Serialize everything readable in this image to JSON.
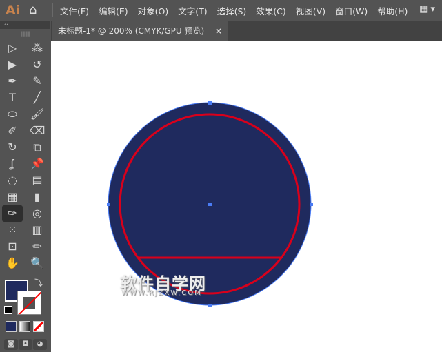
{
  "app": {
    "logo": "Ai",
    "home_icon": "⌂"
  },
  "menu": [
    "文件(F)",
    "编辑(E)",
    "对象(O)",
    "文字(T)",
    "选择(S)",
    "效果(C)",
    "视图(V)",
    "窗口(W)",
    "帮助(H)"
  ],
  "workspace_icon": "▦ ▾",
  "panel": {
    "collapse": "‹‹",
    "grip": "||||||||||"
  },
  "tools": [
    {
      "name": "selection",
      "glyph": "▷"
    },
    {
      "name": "magic-wand",
      "glyph": "⁂"
    },
    {
      "name": "direct-selection",
      "glyph": "▶"
    },
    {
      "name": "lasso",
      "glyph": "↺"
    },
    {
      "name": "pen",
      "glyph": "✒"
    },
    {
      "name": "curvature",
      "glyph": "✎"
    },
    {
      "name": "type",
      "glyph": "T"
    },
    {
      "name": "line",
      "glyph": "╱"
    },
    {
      "name": "ellipse",
      "glyph": "⬭"
    },
    {
      "name": "paintbrush",
      "glyph": "🖌"
    },
    {
      "name": "shaper",
      "glyph": "✐"
    },
    {
      "name": "eraser",
      "glyph": "⌫"
    },
    {
      "name": "rotate",
      "glyph": "↻"
    },
    {
      "name": "scale",
      "glyph": "⧉"
    },
    {
      "name": "warp",
      "glyph": "ʆ"
    },
    {
      "name": "puppet-warp",
      "glyph": "📌"
    },
    {
      "name": "shape-builder",
      "glyph": "◌"
    },
    {
      "name": "perspective-grid",
      "glyph": "▤"
    },
    {
      "name": "mesh",
      "glyph": "▦"
    },
    {
      "name": "gradient",
      "glyph": "▮"
    },
    {
      "name": "eyedropper",
      "glyph": "✑"
    },
    {
      "name": "blend",
      "glyph": "◎"
    },
    {
      "name": "symbol-sprayer",
      "glyph": "⁙"
    },
    {
      "name": "column-graph",
      "glyph": "▥"
    },
    {
      "name": "artboard",
      "glyph": "⊡"
    },
    {
      "name": "slice",
      "glyph": "✏"
    },
    {
      "name": "hand",
      "glyph": "✋"
    },
    {
      "name": "zoom",
      "glyph": "🔍"
    }
  ],
  "colors": {
    "fill": "#1f2a5e",
    "stroke": "#d9001b",
    "selection": "#4a7cf5"
  },
  "swap_icon": "⤵",
  "draw_modes": [
    "◙",
    "◘",
    "◕"
  ],
  "document_tab": {
    "title": "未标题-1* @ 200% (CMYK/GPU 预览)",
    "close": "×"
  },
  "watermark": {
    "text": "软件自学网",
    "url": "WWW.RJZXW.COM"
  }
}
